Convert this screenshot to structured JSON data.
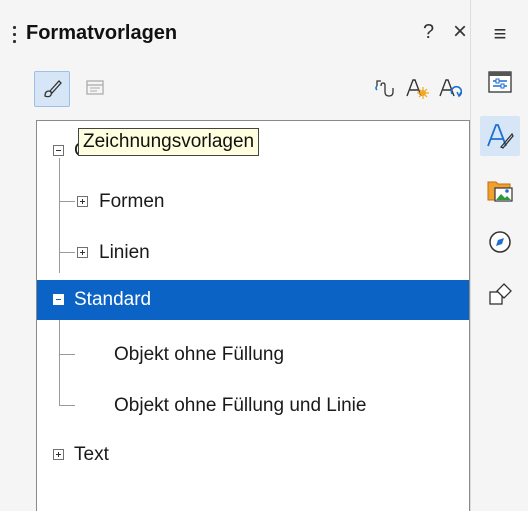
{
  "panel": {
    "title": "Formatvorlagen",
    "help_label": "?",
    "close_label": "×"
  },
  "tooltip": {
    "text": "Zeichnungsvorlagen"
  },
  "tree": {
    "grafik": "Grafik",
    "formen": "Formen",
    "linien": "Linien",
    "standard": "Standard",
    "objekt_ohne_fuellung": "Objekt ohne Füllung",
    "objekt_ohne_fuellung_und_linie": "Objekt ohne Füllung und Linie",
    "text": "Text"
  },
  "deck": {
    "menu_label": "≡"
  },
  "colors": {
    "selection": "#0a63c5",
    "accent": "#1e6fd0",
    "tooltip_bg": "#ffffdf"
  },
  "icons": [
    "drawing-styles-icon",
    "presentation-styles-icon",
    "fill-format-mode-icon",
    "new-style-icon",
    "update-style-icon",
    "properties-icon",
    "styles-icon",
    "gallery-icon",
    "navigator-icon",
    "shapes-icon"
  ]
}
